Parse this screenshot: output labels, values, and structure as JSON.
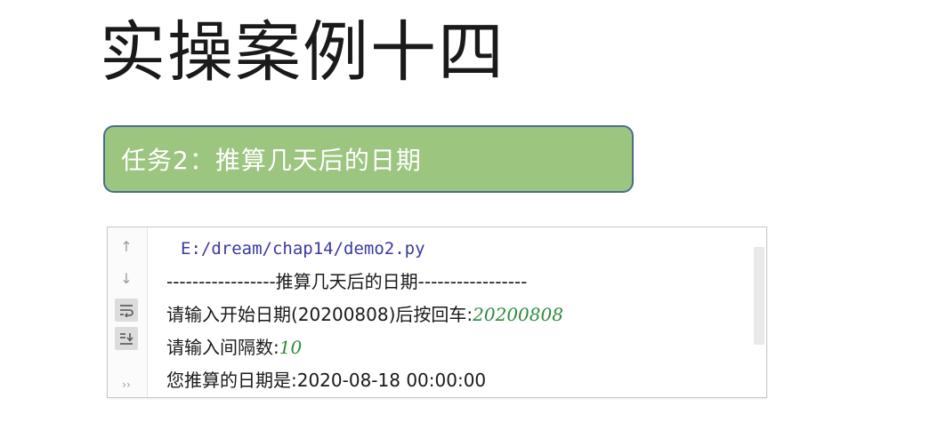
{
  "slide": {
    "title": "实操案例十四",
    "task_banner": "任务2：推算几天后的日期"
  },
  "console": {
    "toolbar": {
      "up_glyph": "↑",
      "down_glyph": "↓",
      "more_glyph": "››"
    },
    "lines": {
      "path": "E:/dream/chap14/demo2.py",
      "header": "-----------------推算几天后的日期-----------------",
      "prompt_start": "请输入开始日期(20200808)后按回车:",
      "input_start": "20200808",
      "prompt_interval": "请输入间隔数:",
      "input_interval": "10",
      "result": "您推算的日期是:2020-08-18 00:00:00"
    },
    "colors": {
      "input_text": "#2e8b3e",
      "path_text": "#3a3aa0",
      "banner_fill": "#9cc57f",
      "banner_border": "#4a6d8a"
    }
  }
}
